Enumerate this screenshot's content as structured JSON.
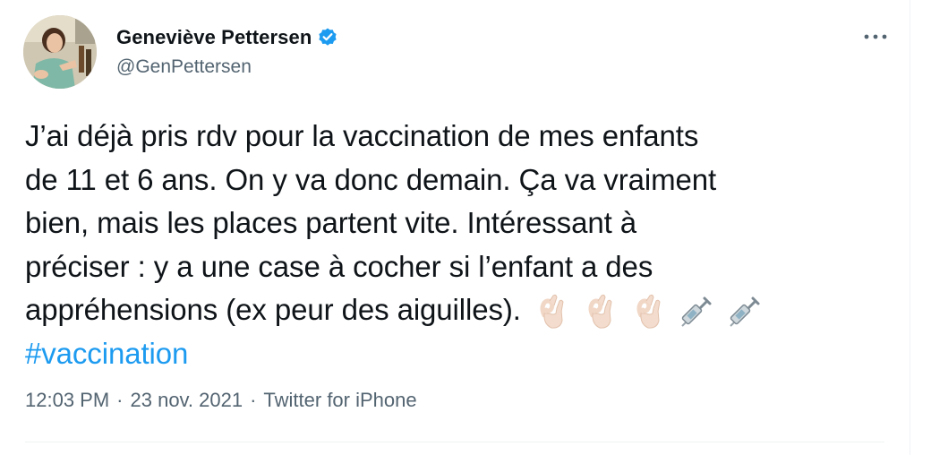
{
  "author": {
    "display_name": "Geneviève Pettersen",
    "handle": "@GenPettersen",
    "verified": true
  },
  "tweet": {
    "lines": [
      "J’ai déjà pris rdv pour la vaccination de mes enfants",
      "de 11 et 6 ans. On y va donc demain. Ça va vraiment",
      "bien, mais les places partent vite. Intéressant à",
      "préciser : y a une case à cocher si l’enfant a des",
      "appréhensions (ex peur des aiguilles)."
    ],
    "emojis": [
      "ok-hand-icon",
      "ok-hand-icon",
      "ok-hand-icon",
      "syringe-icon",
      "syringe-icon"
    ],
    "hashtag": "#vaccination"
  },
  "meta": {
    "time": "12:03 PM",
    "separator": "·",
    "date": "23 nov. 2021",
    "source": "Twitter for iPhone"
  },
  "colors": {
    "link": "#1d9bf0",
    "text": "#0f1419",
    "secondary": "#536471",
    "border": "#eff3f4"
  }
}
